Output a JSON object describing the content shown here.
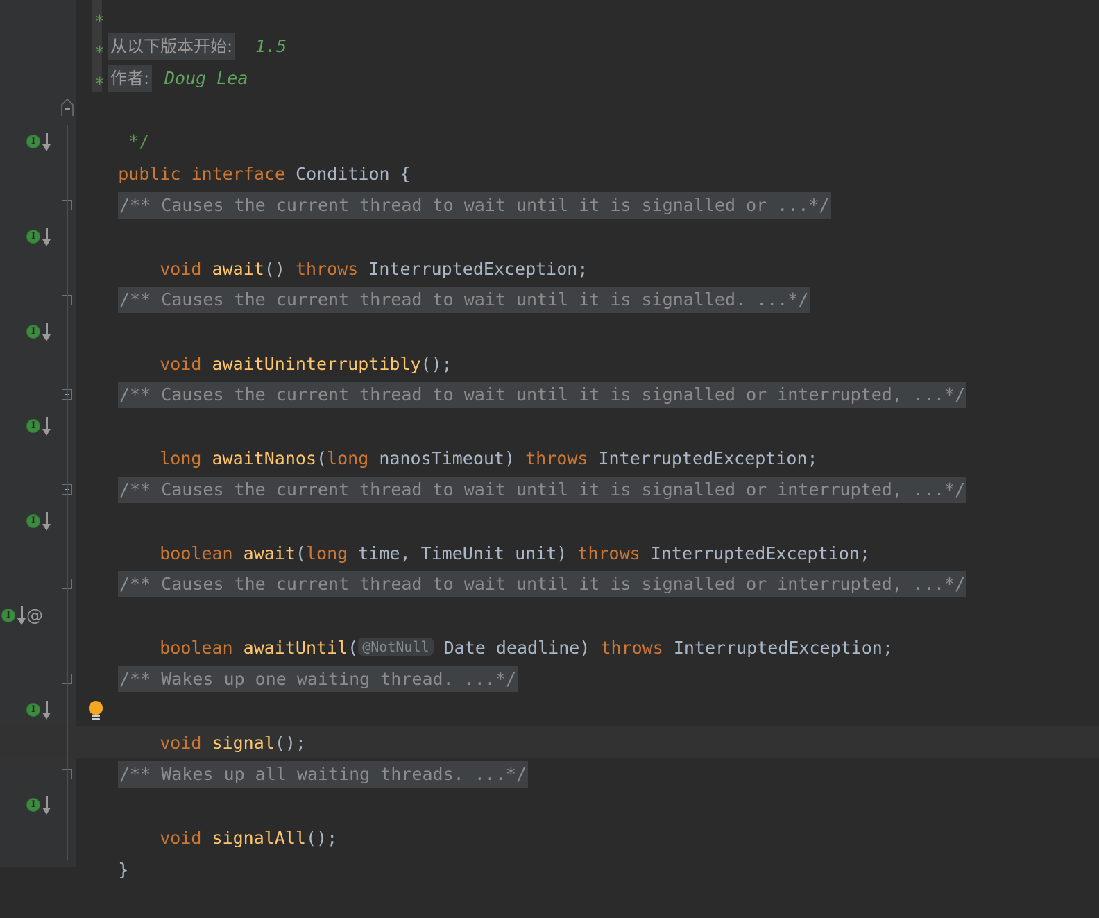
{
  "app": {
    "name": "IntelliJ IDEA Editor",
    "theme": "Darcula",
    "file_type": "Java"
  },
  "colors": {
    "editor_background": "#2b2b2b",
    "gutter_background": "#313335",
    "current_line": "#323232",
    "keyword": "#cc7832",
    "method_name": "#ffc66d",
    "identifier": "#a9b7c6",
    "comment": "#629755",
    "folded_comment_text": "#8c8c8c",
    "folded_comment_background": "#3f4244",
    "inlay_background": "#3c3f41",
    "inlay_text": "#868a8c",
    "impl_marker_green": "#3d8b40",
    "bulb_orange": "#f5a623",
    "javadoc_value_green": "#5fa55f"
  },
  "javadoc_header": {
    "since_label": "从以下版本开始:",
    "since_value": "1.5",
    "author_label": "作者:",
    "author_value": "Doug Lea",
    "close_comment": "*/"
  },
  "declaration": {
    "modifier": "public",
    "keyword": "interface",
    "name": "Condition",
    "open_brace": "{",
    "close_brace": "}"
  },
  "members": [
    {
      "id": "await",
      "folded_comment": "/** Causes the current thread to wait until it is signalled or ...*/",
      "signature_tokens": [
        {
          "text": "void",
          "kind": "kw"
        },
        {
          "text": " ",
          "kind": "pun"
        },
        {
          "text": "await",
          "kind": "mth"
        },
        {
          "text": "()",
          "kind": "pun"
        },
        {
          "text": " ",
          "kind": "pun"
        },
        {
          "text": "throws",
          "kind": "kw"
        },
        {
          "text": " ",
          "kind": "pun"
        },
        {
          "text": "InterruptedException",
          "kind": "typ"
        },
        {
          "text": ";",
          "kind": "pun"
        }
      ],
      "gutter_icons": [
        "implementation-marker"
      ],
      "fold_marker": "plus"
    },
    {
      "id": "awaitUninterruptibly",
      "folded_comment": "/** Causes the current thread to wait until it is signalled. ...*/",
      "signature_tokens": [
        {
          "text": "void",
          "kind": "kw"
        },
        {
          "text": " ",
          "kind": "pun"
        },
        {
          "text": "awaitUninterruptibly",
          "kind": "mth"
        },
        {
          "text": "();",
          "kind": "pun"
        }
      ],
      "gutter_icons": [
        "implementation-marker"
      ],
      "fold_marker": "plus"
    },
    {
      "id": "awaitNanos",
      "folded_comment": "/** Causes the current thread to wait until it is signalled or interrupted, ...*/",
      "signature_tokens": [
        {
          "text": "long",
          "kind": "kw"
        },
        {
          "text": " ",
          "kind": "pun"
        },
        {
          "text": "awaitNanos",
          "kind": "mth"
        },
        {
          "text": "(",
          "kind": "pun"
        },
        {
          "text": "long",
          "kind": "kw"
        },
        {
          "text": " ",
          "kind": "pun"
        },
        {
          "text": "nanosTimeout",
          "kind": "par"
        },
        {
          "text": ")",
          "kind": "pun"
        },
        {
          "text": " ",
          "kind": "pun"
        },
        {
          "text": "throws",
          "kind": "kw"
        },
        {
          "text": " ",
          "kind": "pun"
        },
        {
          "text": "InterruptedException",
          "kind": "typ"
        },
        {
          "text": ";",
          "kind": "pun"
        }
      ],
      "gutter_icons": [
        "implementation-marker"
      ],
      "fold_marker": "plus"
    },
    {
      "id": "awaitTimed",
      "folded_comment": "/** Causes the current thread to wait until it is signalled or interrupted, ...*/",
      "signature_tokens": [
        {
          "text": "boolean",
          "kind": "kw"
        },
        {
          "text": " ",
          "kind": "pun"
        },
        {
          "text": "await",
          "kind": "mth"
        },
        {
          "text": "(",
          "kind": "pun"
        },
        {
          "text": "long",
          "kind": "kw"
        },
        {
          "text": " ",
          "kind": "pun"
        },
        {
          "text": "time",
          "kind": "par"
        },
        {
          "text": ", ",
          "kind": "pun"
        },
        {
          "text": "TimeUnit",
          "kind": "typ"
        },
        {
          "text": " ",
          "kind": "pun"
        },
        {
          "text": "unit",
          "kind": "par"
        },
        {
          "text": ")",
          "kind": "pun"
        },
        {
          "text": " ",
          "kind": "pun"
        },
        {
          "text": "throws",
          "kind": "kw"
        },
        {
          "text": " ",
          "kind": "pun"
        },
        {
          "text": "InterruptedException",
          "kind": "typ"
        },
        {
          "text": ";",
          "kind": "pun"
        }
      ],
      "gutter_icons": [
        "implementation-marker"
      ],
      "fold_marker": "plus"
    },
    {
      "id": "awaitUntil",
      "folded_comment": "/** Causes the current thread to wait until it is signalled or interrupted, ...*/",
      "annotation_inlay": "@NotNull",
      "signature_tokens": [
        {
          "text": "boolean",
          "kind": "kw"
        },
        {
          "text": " ",
          "kind": "pun"
        },
        {
          "text": "awaitUntil",
          "kind": "mth"
        },
        {
          "text": "(",
          "kind": "pun"
        }
      ],
      "signature_tokens_after": [
        {
          "text": " ",
          "kind": "pun"
        },
        {
          "text": "Date",
          "kind": "typ"
        },
        {
          "text": " ",
          "kind": "pun"
        },
        {
          "text": "deadline",
          "kind": "par"
        },
        {
          "text": ")",
          "kind": "pun"
        },
        {
          "text": " ",
          "kind": "pun"
        },
        {
          "text": "throws",
          "kind": "kw"
        },
        {
          "text": " ",
          "kind": "pun"
        },
        {
          "text": "InterruptedException",
          "kind": "typ"
        },
        {
          "text": ";",
          "kind": "pun"
        }
      ],
      "gutter_icons": [
        "implementation-marker",
        "annotation-marker"
      ],
      "fold_marker": "plus"
    },
    {
      "id": "signal",
      "folded_comment": "/** Wakes up one waiting thread. ...*/",
      "signature_tokens": [
        {
          "text": "void",
          "kind": "kw"
        },
        {
          "text": " ",
          "kind": "pun"
        },
        {
          "text": "signal",
          "kind": "mth"
        },
        {
          "text": "();",
          "kind": "pun"
        }
      ],
      "gutter_icons": [
        "implementation-marker"
      ],
      "fold_marker": "plus",
      "has_intention_bulb": true
    },
    {
      "id": "signalAll",
      "folded_comment": "/** Wakes up all waiting threads. ...*/",
      "signature_tokens": [
        {
          "text": "void",
          "kind": "kw"
        },
        {
          "text": " ",
          "kind": "pun"
        },
        {
          "text": "signalAll",
          "kind": "mth"
        },
        {
          "text": "();",
          "kind": "pun"
        }
      ],
      "gutter_icons": [
        "implementation-marker"
      ],
      "fold_marker": "plus"
    }
  ],
  "gutter": {
    "impl_icon_letter": "I",
    "annotation_icon_glyph": "@",
    "fold_plus_glyph": "+",
    "fold_end_glyph": "-"
  }
}
